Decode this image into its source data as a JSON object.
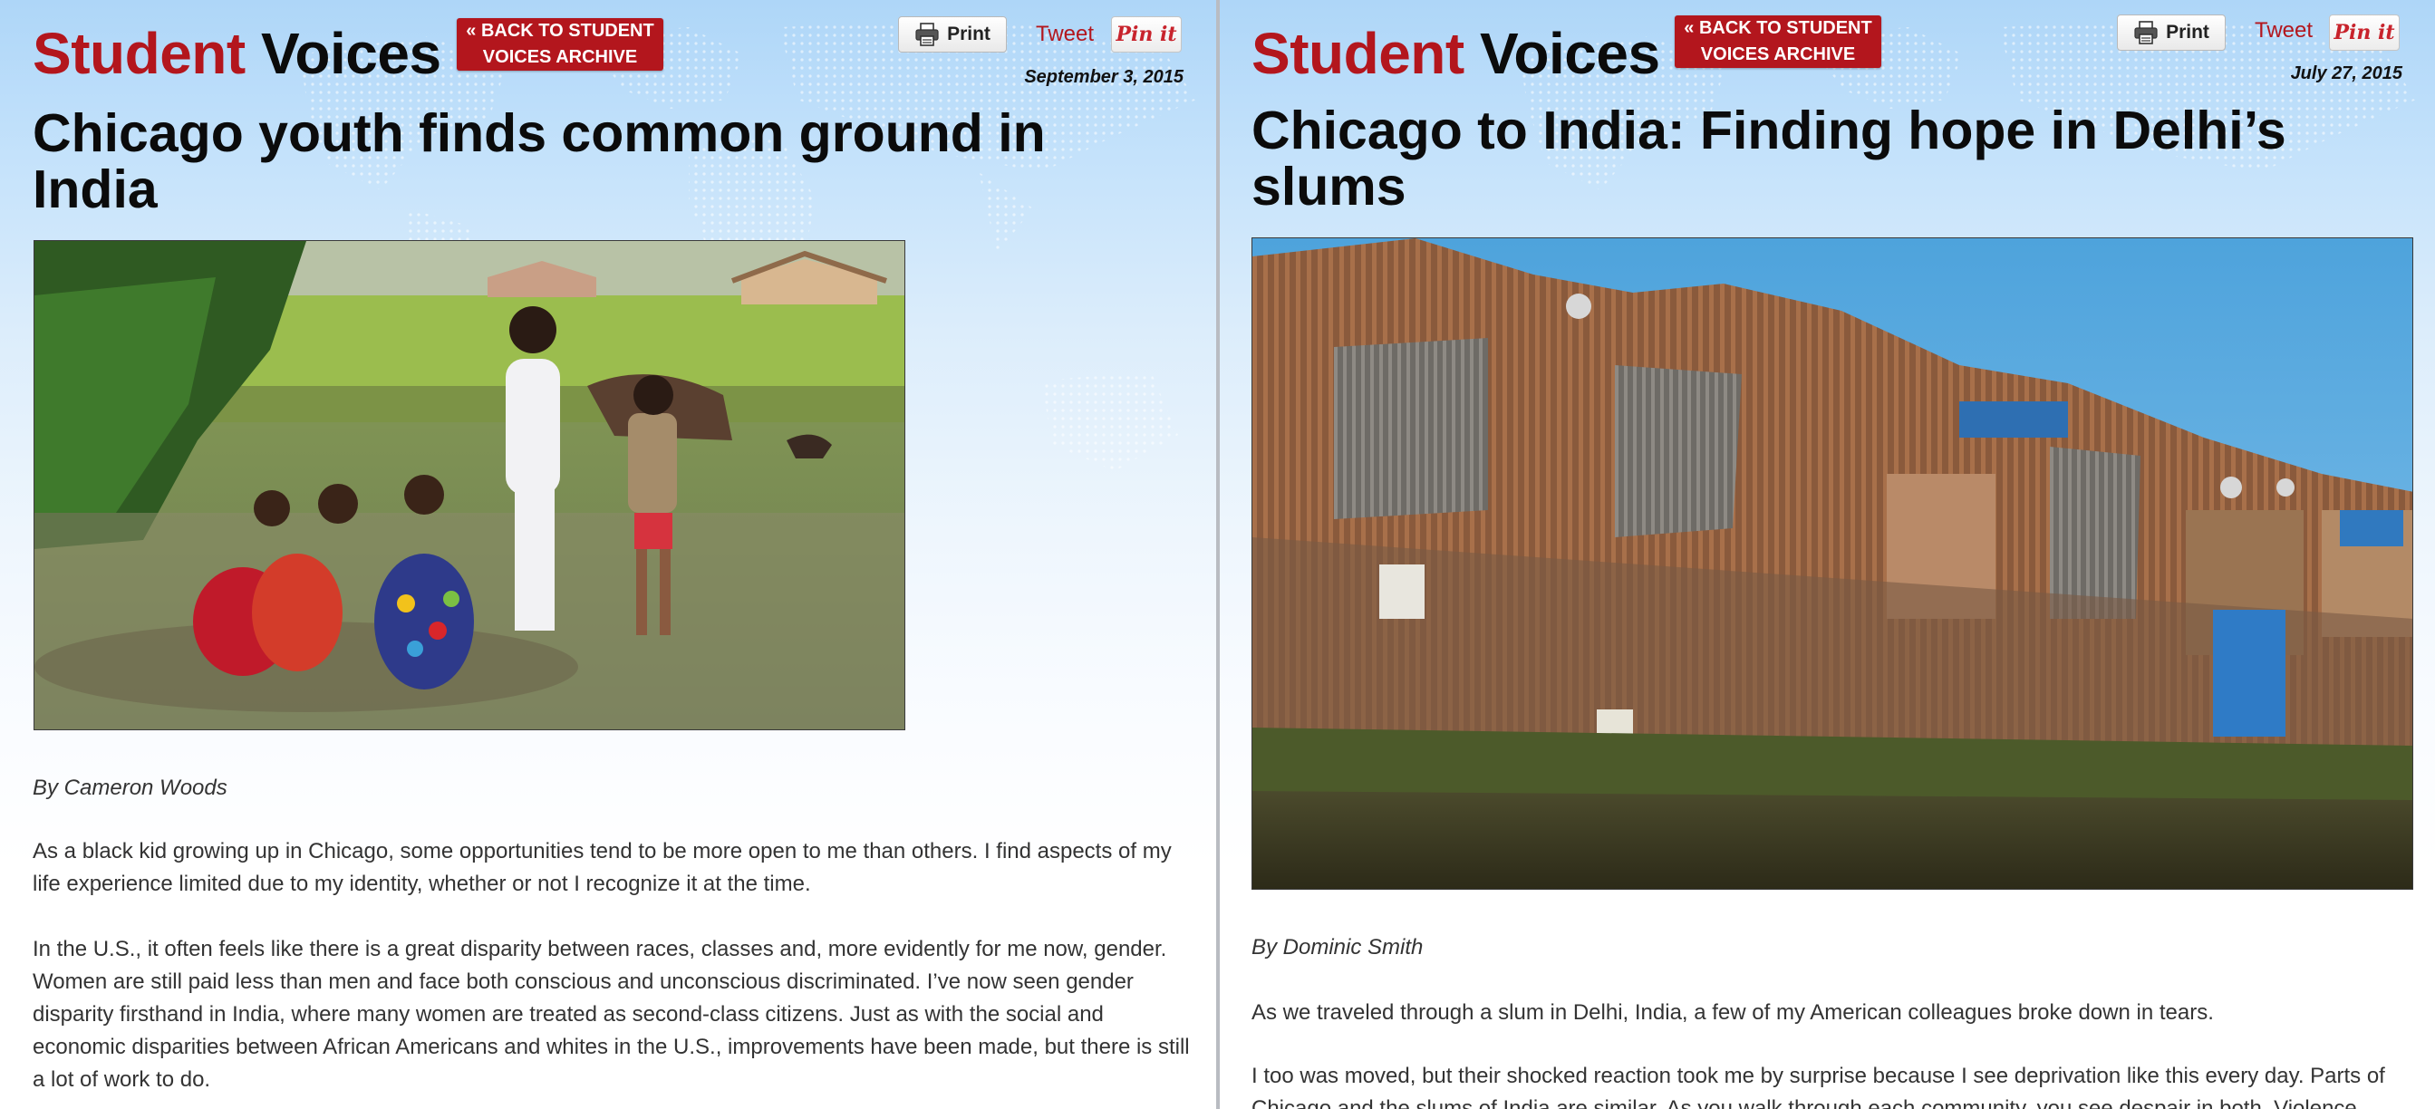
{
  "left": {
    "brand_word1": "Student",
    "brand_word2": "Voices",
    "back_button": "« BACK TO STUDENT\nVOICES ARCHIVE",
    "print_label": "Print",
    "tweet_label": "Tweet",
    "pin_label": "Pin it",
    "date": "September 3, 2015",
    "title": "Chicago youth finds common ground in India",
    "byline": "By Cameron Woods",
    "paragraphs": [
      "As a black kid growing up in Chicago, some opportunities tend to be more open to me than others. I find aspects of my life experience limited due to my identity, whether or not I recognize it at the time.",
      "In the U.S., it often feels like there is a great disparity between races, classes and, more evidently for me now, gender. Women are still paid less than men and face both conscious and unconscious discriminated. I’ve now seen gender disparity firsthand in India, where many women are treated as second-class citizens. Just as with the social and economic disparities between African Americans and whites in the U.S., improvements have been made, but there is still a lot of work to do."
    ]
  },
  "right": {
    "brand_word1": "Student",
    "brand_word2": "Voices",
    "back_button": "« BACK TO STUDENT\nVOICES ARCHIVE",
    "print_label": "Print",
    "tweet_label": "Tweet",
    "pin_label": "Pin it",
    "date": "July 27, 2015",
    "title": "Chicago to India: Finding hope in Delhi’s slums",
    "byline": "By Dominic Smith",
    "paragraphs": [
      "As we traveled through a slum in Delhi, India, a few of my American colleagues broke down in tears.",
      "I too was moved, but their shocked reaction took me by surprise because I see deprivation like this every day. Parts of Chicago and the slums of India are similar. As you walk through each community, you see despair in both. Violence"
    ]
  },
  "icons": {
    "print": "printer-icon",
    "back": "double-chevron-left-icon",
    "pin": "pinterest-icon"
  },
  "colors": {
    "brand_red": "#b3161d",
    "sky_top": "#aed6f8",
    "text": "#333333"
  }
}
